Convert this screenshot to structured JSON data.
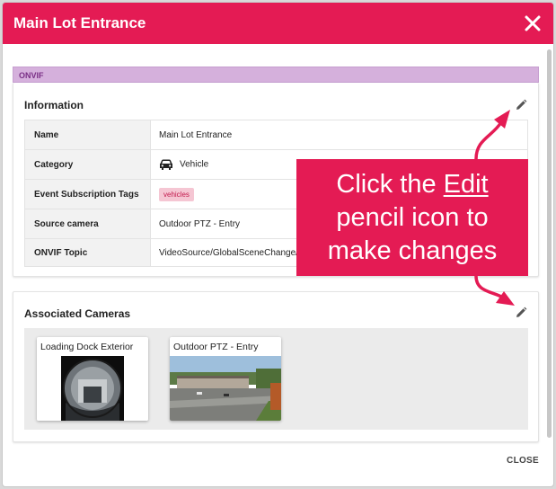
{
  "dialog": {
    "title": "Main Lot Entrance",
    "close_label": "CLOSE"
  },
  "source_badge": "ONVIF",
  "information": {
    "title": "Information",
    "rows": [
      {
        "key": "Name",
        "value": "Main Lot Entrance"
      },
      {
        "key": "Category",
        "value": "Vehicle",
        "icon": "car-icon"
      },
      {
        "key": "Event Subscription Tags",
        "tag": "vehicles"
      },
      {
        "key": "Source camera",
        "value": "Outdoor PTZ - Entry"
      },
      {
        "key": "ONVIF Topic",
        "value": "VideoSource/GlobalSceneChange/ImagingService"
      }
    ]
  },
  "associated_cameras": {
    "title": "Associated Cameras",
    "cameras": [
      {
        "name": "Loading Dock Exterior"
      },
      {
        "name": "Outdoor PTZ - Entry"
      }
    ]
  },
  "callout": {
    "line1_prefix": "Click the ",
    "line1_link": "Edit",
    "line2": "pencil icon to",
    "line3": "make changes"
  },
  "colors": {
    "accent": "#e41b54",
    "badge_bg": "#d5b0dc",
    "tag_bg": "#f5c6d3"
  },
  "icons": [
    "close-icon",
    "pencil-icon",
    "car-icon"
  ]
}
